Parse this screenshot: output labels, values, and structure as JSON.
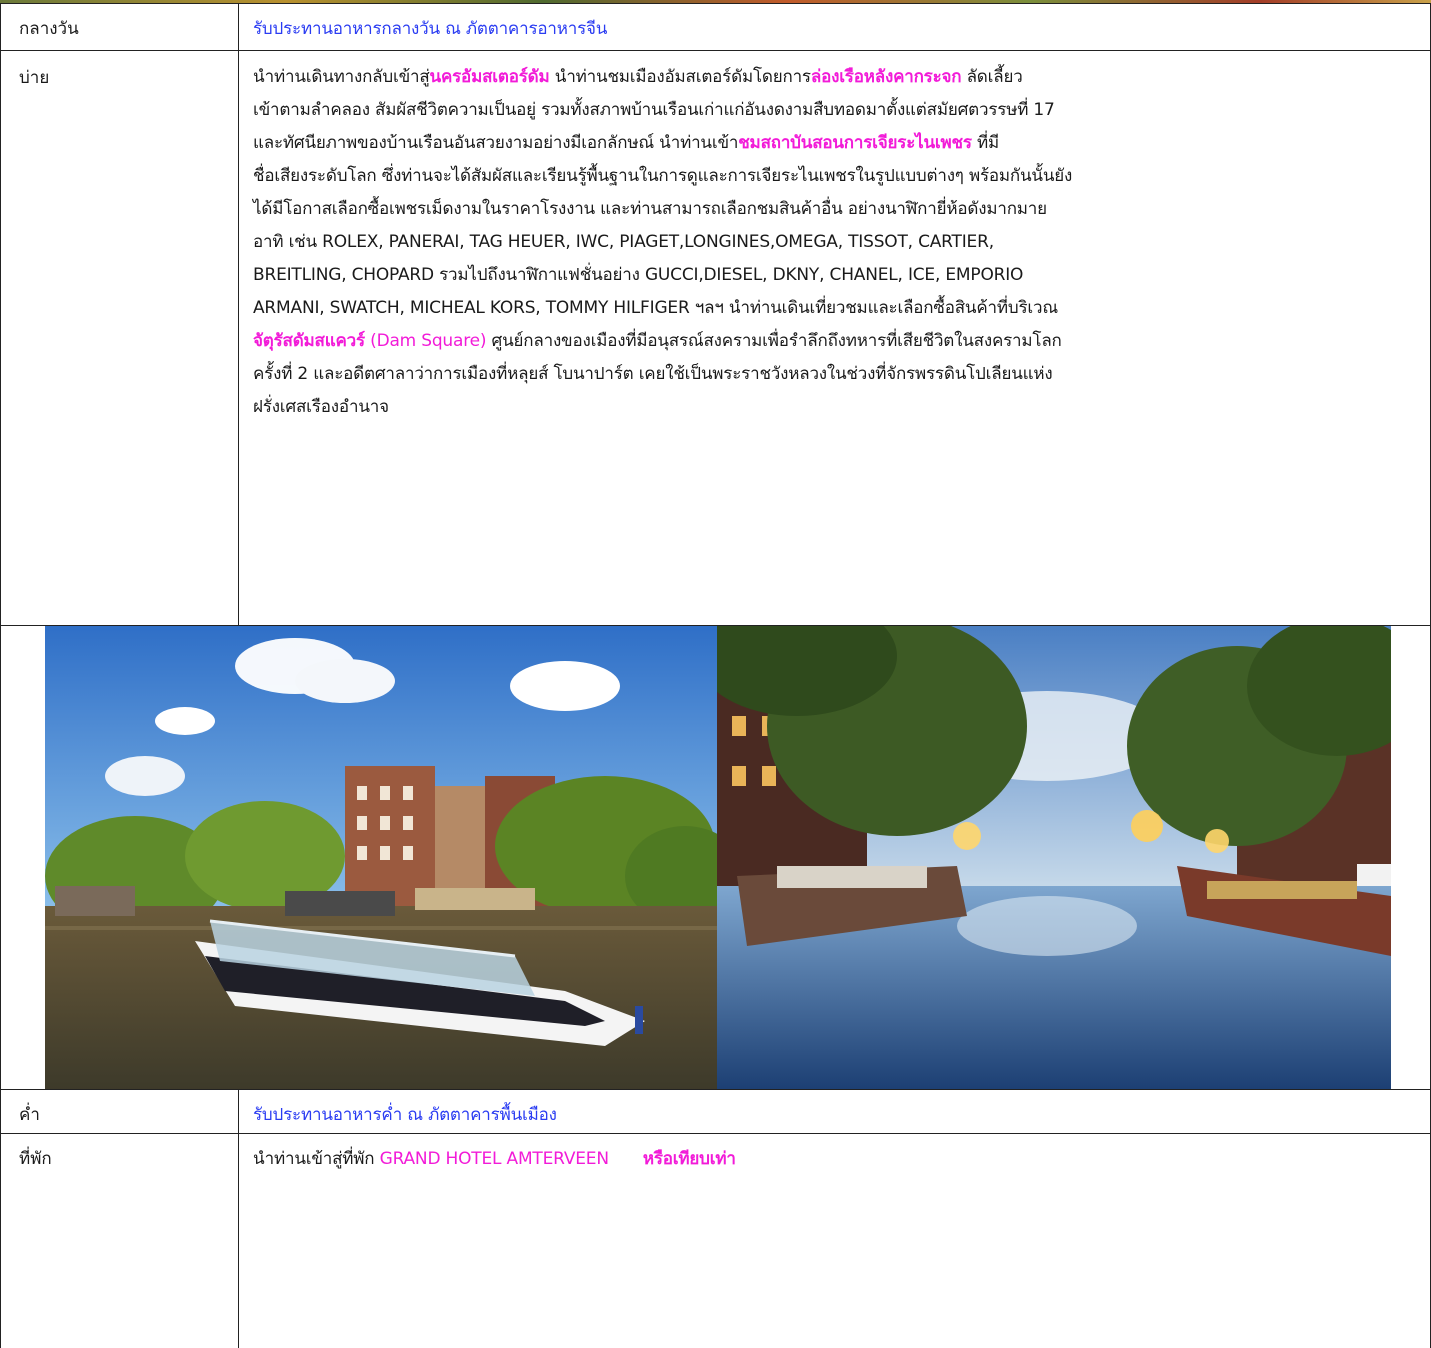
{
  "rows": {
    "lunch": {
      "label": "กลางวัน",
      "text": "รับประทานอาหารกลางวัน ณ ภัตตาคารอาหารจีน"
    },
    "afternoon": {
      "label": "บ่าย",
      "lines": [
        [
          "นำท่านเดินทางกลับเข้าสู่",
          "นครอัมสเตอร์ดัม",
          " นำท่านชมเมืองอัมสเตอร์ดัมโดยการ",
          "ล่องเรือหลังคากระจก",
          " ลัดเลี้ยว"
        ],
        [
          "เข้าตามลำคลอง สัมผัสชีวิตความเป็นอยู่ รวมทั้งสภาพบ้านเรือนเก่าแก่อันงดงามสืบทอดมาตั้งแต่สมัยศตวรรษที่ 17"
        ],
        [
          "และทัศนียภาพของบ้านเรือนอันสวยงามอย่างมีเอกลักษณ์ นำท่านเข้า",
          "ชมสถาบันสอนการเจียระไนเพชร",
          " ที่มี"
        ],
        [
          "ชื่อเสียงระดับโลก ซึ่งท่านจะได้สัมผัสและเรียนรู้พื้นฐานในการดูและการเจียระไนเพชรในรูปแบบต่างๆ พร้อมกันนั้นยัง"
        ],
        [
          "ได้มีโอกาสเลือกซื้อเพชรเม็ดงามในราคาโรงงาน และท่านสามารถเลือกชมสินค้าอื่น อย่างนาฬิกายี่ห้อดังมากมาย"
        ],
        [
          "อาทิ เช่น ROLEX, PANERAI,  TAG HEUER, IWC,  PIAGET,LONGINES,OMEGA, TISSOT, CARTIER,"
        ],
        [
          "BREITLING, CHOPARD รวมไปถึงนาฬิกาแฟชั่นอย่าง GUCCI,DIESEL, DKNY, CHANEL,  ICE,  EMPORIO"
        ],
        [
          "ARMANI,  SWATCH, MICHEAL  KORS, TOMMY HILFIGER ฯลฯ นำท่านเดินเที่ยวชมและเลือกซื้อสินค้าที่บริเวณ"
        ],
        [
          "จัตุรัสดัมสแควร์",
          " (Dam Square)",
          " ศูนย์กลางของเมืองที่มีอนุสรณ์สงครามเพื่อรำลึกถึงทหารที่เสียชีวิตในสงครามโลก"
        ],
        [
          "ครั้งที่ 2 และอดีตศาลาว่าการเมืองที่หลุยส์ โบนาปาร์ต เคยใช้เป็นพระราชวังหลวงในช่วงที่จักรพรรดินโปเลียนแห่ง"
        ],
        [
          "ฝรั่งเศสเรืองอำนาจ"
        ]
      ]
    },
    "dinner": {
      "label": "ค่ำ",
      "text": "รับประทานอาหารค่ำ ณ ภัตตาคารพื้นเมือง"
    },
    "hotel": {
      "label": "ที่พัก",
      "prefix": "นำท่านเข้าสู่ที่พัก ",
      "hotel_name": "GRAND HOTEL AMTERVEEN",
      "suffix": "หรือเทียบเท่า"
    }
  },
  "colors": {
    "meal_text": "#2a3cf2",
    "highlight": "#f21bd8",
    "border": "#222222"
  },
  "photos": {
    "left": "amsterdam-canal-cruise-photo",
    "right": "amsterdam-canal-dusk-photo"
  }
}
